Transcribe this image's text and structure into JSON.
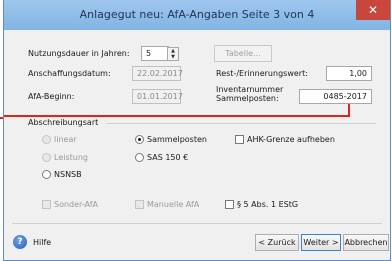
{
  "window": {
    "title": "Anlagegut neu: AfA-Angaben Seite 3 von 4",
    "close_symbol": "✕"
  },
  "fields": {
    "nutzungsdauer_label": "Nutzungsdauer in Jahren:",
    "nutzungsdauer_value": "5",
    "tabelle_label": "Tabelle...",
    "anschaffungsdatum_label": "Anschaffungsdatum:",
    "anschaffungsdatum_value": "22.02.2017",
    "restwert_label": "Rest-/Erinnerungswert:",
    "restwert_value": "1,00",
    "afa_beginn_label": "AfA-Beginn:",
    "afa_beginn_value": "01.01.2017",
    "inventarnummer_label_line1": "Inventarnummer",
    "inventarnummer_label_line2": "Sammelposten:",
    "inventarnummer_value": "0485-2017"
  },
  "abschreibungsart": {
    "heading": "Abschreibungsart",
    "linear": "linear",
    "sammelposten": "Sammelposten",
    "ahk_grenze": "AHK-Grenze aufheben",
    "leistung": "Leistung",
    "sas": "SAS 150 €",
    "nsnsb": "NSNSB"
  },
  "options": {
    "sonder_afa": "Sonder-AfA",
    "manuelle_afa": "Manuelle AfA",
    "estg": "§ 5 Abs. 1 EStG"
  },
  "footer": {
    "help_icon_glyph": "?",
    "hilfe": "Hilfe",
    "zurueck": "< Zurück",
    "weiter": "Weiter >",
    "abbrechen": "Abbrechen"
  },
  "colors": {
    "titlebar": "#9ec7ee",
    "close": "#c9463d",
    "callout": "#e2231a"
  }
}
